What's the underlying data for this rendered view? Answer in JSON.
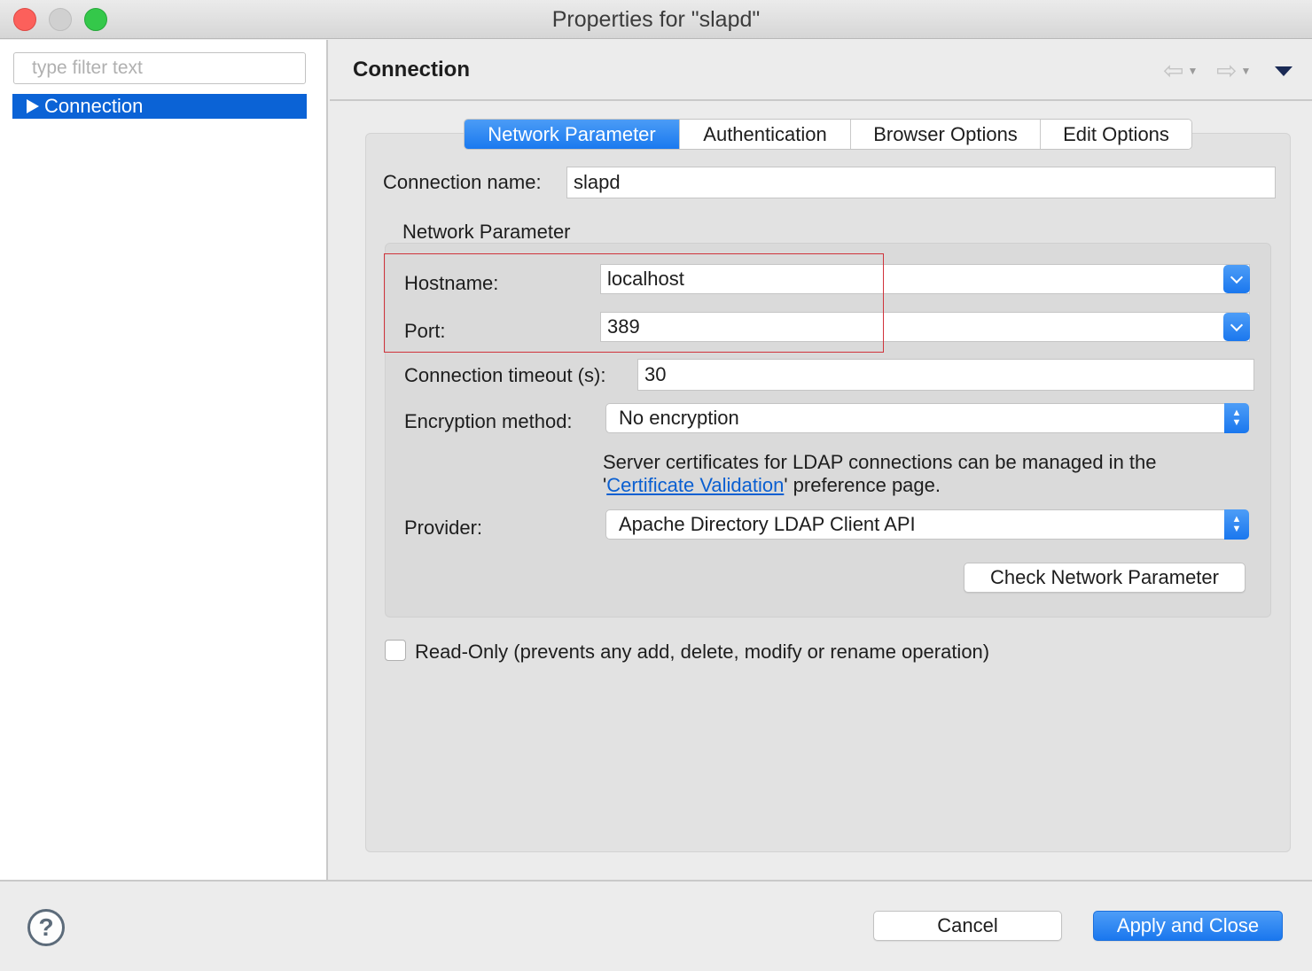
{
  "window": {
    "title": "Properties for \"slapd\""
  },
  "sidebar": {
    "filter_placeholder": "type filter text",
    "items": [
      {
        "label": "Connection",
        "selected": true
      }
    ]
  },
  "page": {
    "title": "Connection"
  },
  "tabs": [
    {
      "label": "Network Parameter",
      "active": true
    },
    {
      "label": "Authentication",
      "active": false
    },
    {
      "label": "Browser Options",
      "active": false
    },
    {
      "label": "Edit Options",
      "active": false
    }
  ],
  "form": {
    "connection_name_label": "Connection name:",
    "connection_name_value": "slapd",
    "group_title": "Network Parameter",
    "hostname_label": "Hostname:",
    "hostname_value": "localhost",
    "port_label": "Port:",
    "port_value": "389",
    "timeout_label": "Connection timeout (s):",
    "timeout_value": "30",
    "encryption_label": "Encryption method:",
    "encryption_value": "No encryption",
    "cert_note_line1": "Server certificates for LDAP connections can be managed in the",
    "cert_note_prefix": "'",
    "cert_note_link": "Certificate Validation",
    "cert_note_suffix": "' preference page.",
    "provider_label": "Provider:",
    "provider_value": "Apache Directory LDAP Client API",
    "check_button": "Check Network Parameter",
    "readonly_label": "Read-Only (prevents any add, delete, modify or rename operation)",
    "readonly_checked": false
  },
  "footer": {
    "help_glyph": "?",
    "cancel_label": "Cancel",
    "apply_label": "Apply and Close"
  },
  "colors": {
    "accent": "#1a79ef",
    "selection": "#0b63d6",
    "highlight_border": "#d0333b",
    "link": "#0a5fd1"
  },
  "icons": [
    "close-window-icon",
    "minimize-window-icon",
    "maximize-window-icon",
    "back-arrow-icon",
    "forward-arrow-icon",
    "view-menu-icon",
    "tree-expand-icon",
    "chevron-down-icon",
    "up-down-arrows-icon",
    "help-icon"
  ]
}
